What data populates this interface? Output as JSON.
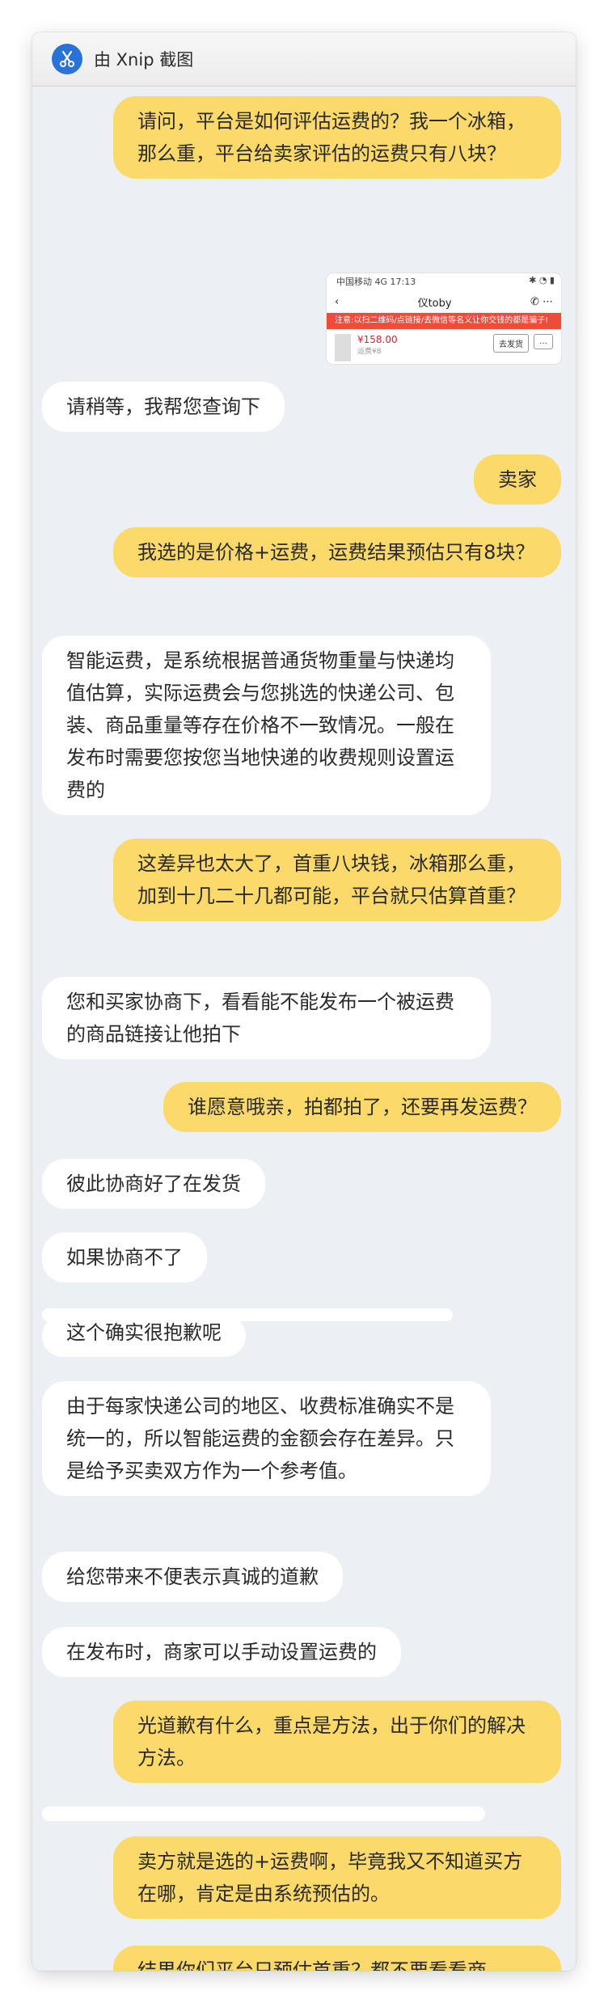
{
  "window": {
    "title": "由 Xnip 截图"
  },
  "screenshot_preview": {
    "status_left": "中国移动 4G 17:13",
    "status_right": "✱ ◔ ▮",
    "shop_name": "仪toby",
    "notice": "注意:以扫二维码/点链接/去微信等名义让你交钱的都是骗子!",
    "price": "¥158.00",
    "sub": "运费¥8",
    "button": "去发货",
    "more": "…"
  },
  "messages": [
    {
      "from": "me",
      "text": "请问，平台是如何评估运费的？我一个冰箱，那么重，平台给卖家评估的运费只有八块？"
    },
    {
      "from": "them",
      "text": "请稍等，我帮您查询下"
    },
    {
      "from": "me",
      "text": "卖家"
    },
    {
      "from": "me",
      "text": "我选的是价格+运费，运费结果预估只有8块？"
    },
    {
      "from": "them",
      "text": "智能运费，是系统根据普通货物重量与快递均值估算，实际运费会与您挑选的快递公司、包装、商品重量等存在价格不一致情况。一般在发布时需要您按您当地快递的收费规则设置运费的"
    },
    {
      "from": "me",
      "text": "这差异也太大了，首重八块钱，冰箱那么重，加到十几二十几都可能，平台就只估算首重？"
    },
    {
      "from": "them",
      "text": "您和买家协商下，看看能不能发布一个被运费的商品链接让他拍下"
    },
    {
      "from": "me",
      "text": "谁愿意哦亲，拍都拍了，还要再发运费？"
    },
    {
      "from": "them",
      "text": "彼此协商好了在发货"
    },
    {
      "from": "them",
      "text": "如果协商不了"
    },
    {
      "from": "them",
      "text": "这个确实很抱歉呢"
    },
    {
      "from": "them",
      "text": "由于每家快递公司的地区、收费标准确实不是统一的，所以智能运费的金额会存在差异。只是给予买卖双方作为一个参考值。"
    },
    {
      "from": "them",
      "text": "给您带来不便表示真诚的道歉"
    },
    {
      "from": "them",
      "text": "在发布时，商家可以手动设置运费的"
    },
    {
      "from": "me",
      "text": "光道歉有什么，重点是方法，出于你们的解决方法。"
    },
    {
      "from": "me",
      "text": "卖方就是选的+运费啊，毕竟我又不知道买方在哪，肯定是由系统预估的。"
    },
    {
      "from": "me",
      "text": "结果你们平台只预估首重？都不要看看商"
    }
  ],
  "colors": {
    "me_bubble": "#fbd96a",
    "them_bubble": "#ffffff",
    "chat_bg": "#eceff4"
  }
}
